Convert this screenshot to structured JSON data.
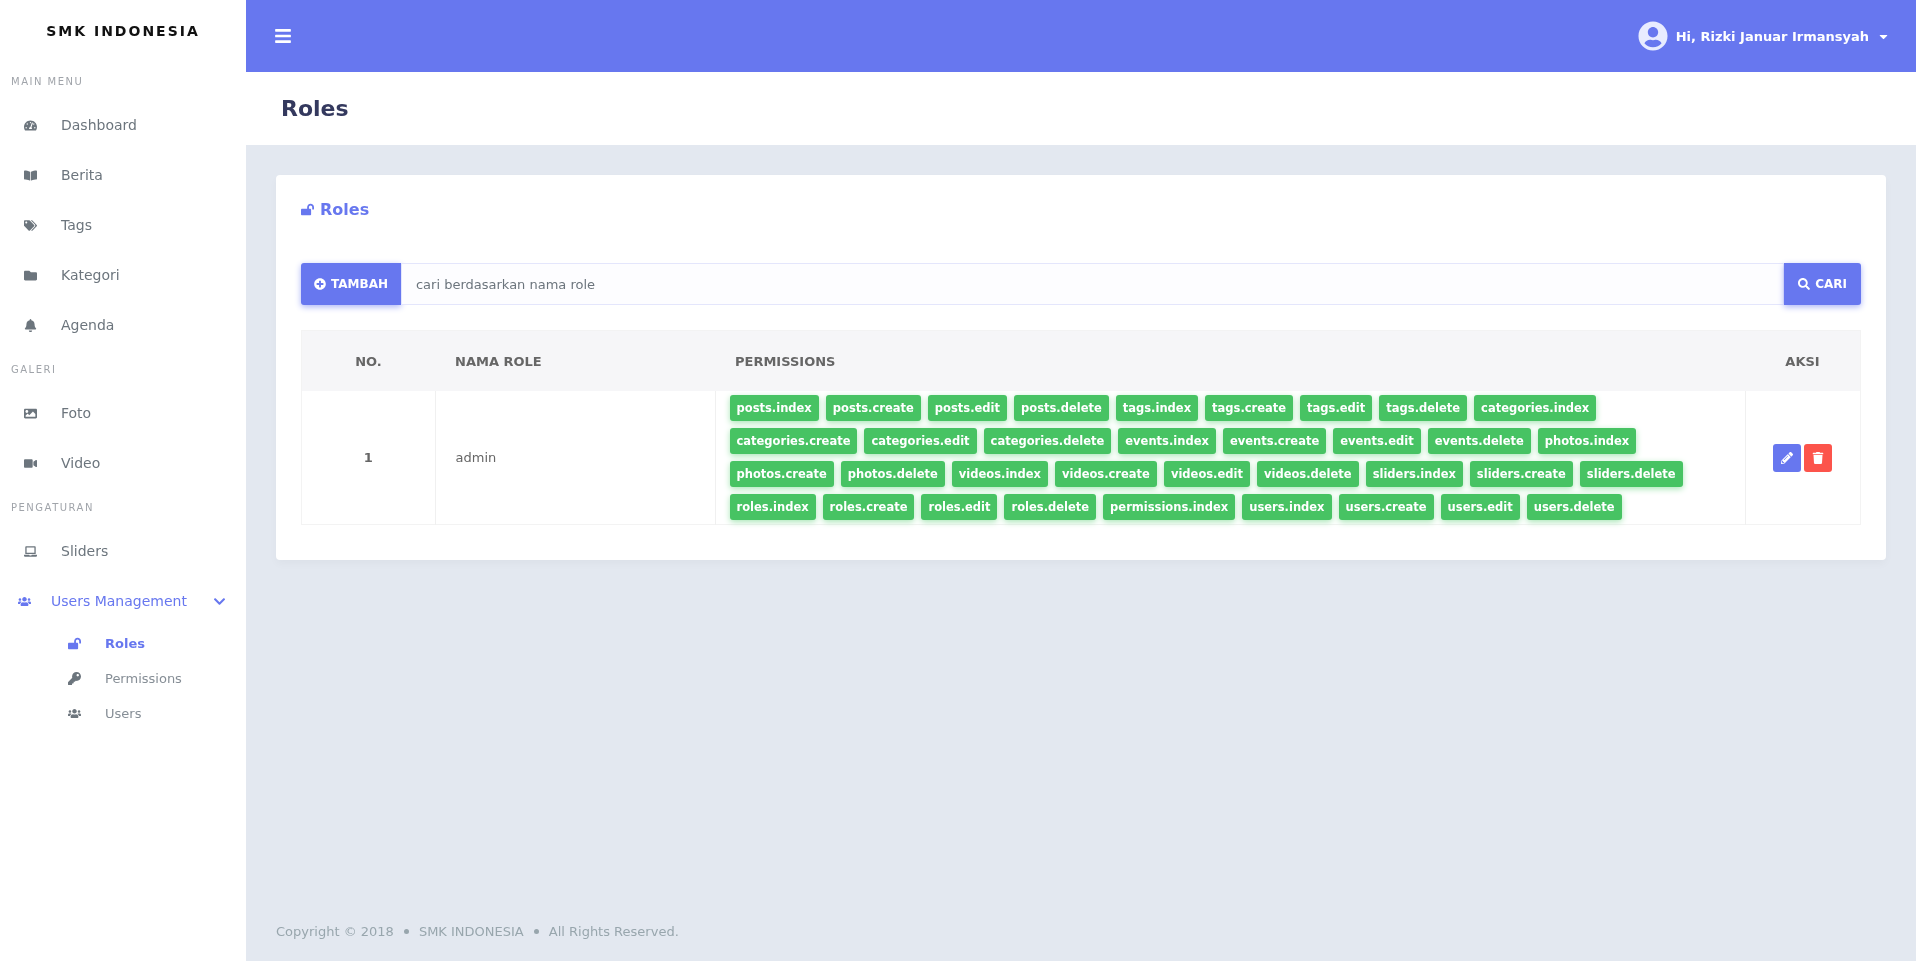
{
  "sidebar": {
    "brand": "SMK INDONESIA",
    "sections": [
      {
        "title": "MAIN MENU",
        "items": [
          {
            "label": "Dashboard",
            "selected": false
          },
          {
            "label": "Berita",
            "selected": false
          },
          {
            "label": "Tags",
            "selected": false
          },
          {
            "label": "Kategori",
            "selected": false
          },
          {
            "label": "Agenda",
            "selected": false
          }
        ]
      },
      {
        "title": "GALERI",
        "items": [
          {
            "label": "Foto",
            "selected": false
          },
          {
            "label": "Video",
            "selected": false
          }
        ]
      },
      {
        "title": "PENGATURAN",
        "items": [
          {
            "label": "Sliders",
            "selected": false
          },
          {
            "label": "Users Management",
            "selected": true,
            "expanded": true,
            "children": [
              {
                "label": "Roles",
                "selected": true
              },
              {
                "label": "Permissions",
                "selected": false
              },
              {
                "label": "Users",
                "selected": false
              }
            ]
          }
        ]
      }
    ]
  },
  "topbar": {
    "user": "Hi, Rizki Januar Irmansyah"
  },
  "page_title": "Roles",
  "card": {
    "title": "Roles",
    "add_button": "TAMBAH",
    "search": {
      "placeholder": "cari berdasarkan nama role"
    },
    "search_button": "CARI",
    "table": {
      "columns": [
        "NO.",
        "NAMA ROLE",
        "PERMISSIONS",
        "AKSI"
      ],
      "rows": [
        {
          "no": "1",
          "name": "admin",
          "permissions": [
            "posts.index",
            "posts.create",
            "posts.edit",
            "posts.delete",
            "tags.index",
            "tags.create",
            "tags.edit",
            "tags.delete",
            "categories.index",
            "categories.create",
            "categories.edit",
            "categories.delete",
            "events.index",
            "events.create",
            "events.edit",
            "events.delete",
            "photos.index",
            "photos.create",
            "photos.delete",
            "videos.index",
            "videos.create",
            "videos.edit",
            "videos.delete",
            "sliders.index",
            "sliders.create",
            "sliders.delete",
            "roles.index",
            "roles.create",
            "roles.edit",
            "roles.delete",
            "permissions.index",
            "users.index",
            "users.create",
            "users.edit",
            "users.delete"
          ]
        }
      ]
    }
  },
  "footer": {
    "parts": [
      "Copyright © 2018",
      "SMK INDONESIA",
      "All Rights Reserved."
    ]
  }
}
